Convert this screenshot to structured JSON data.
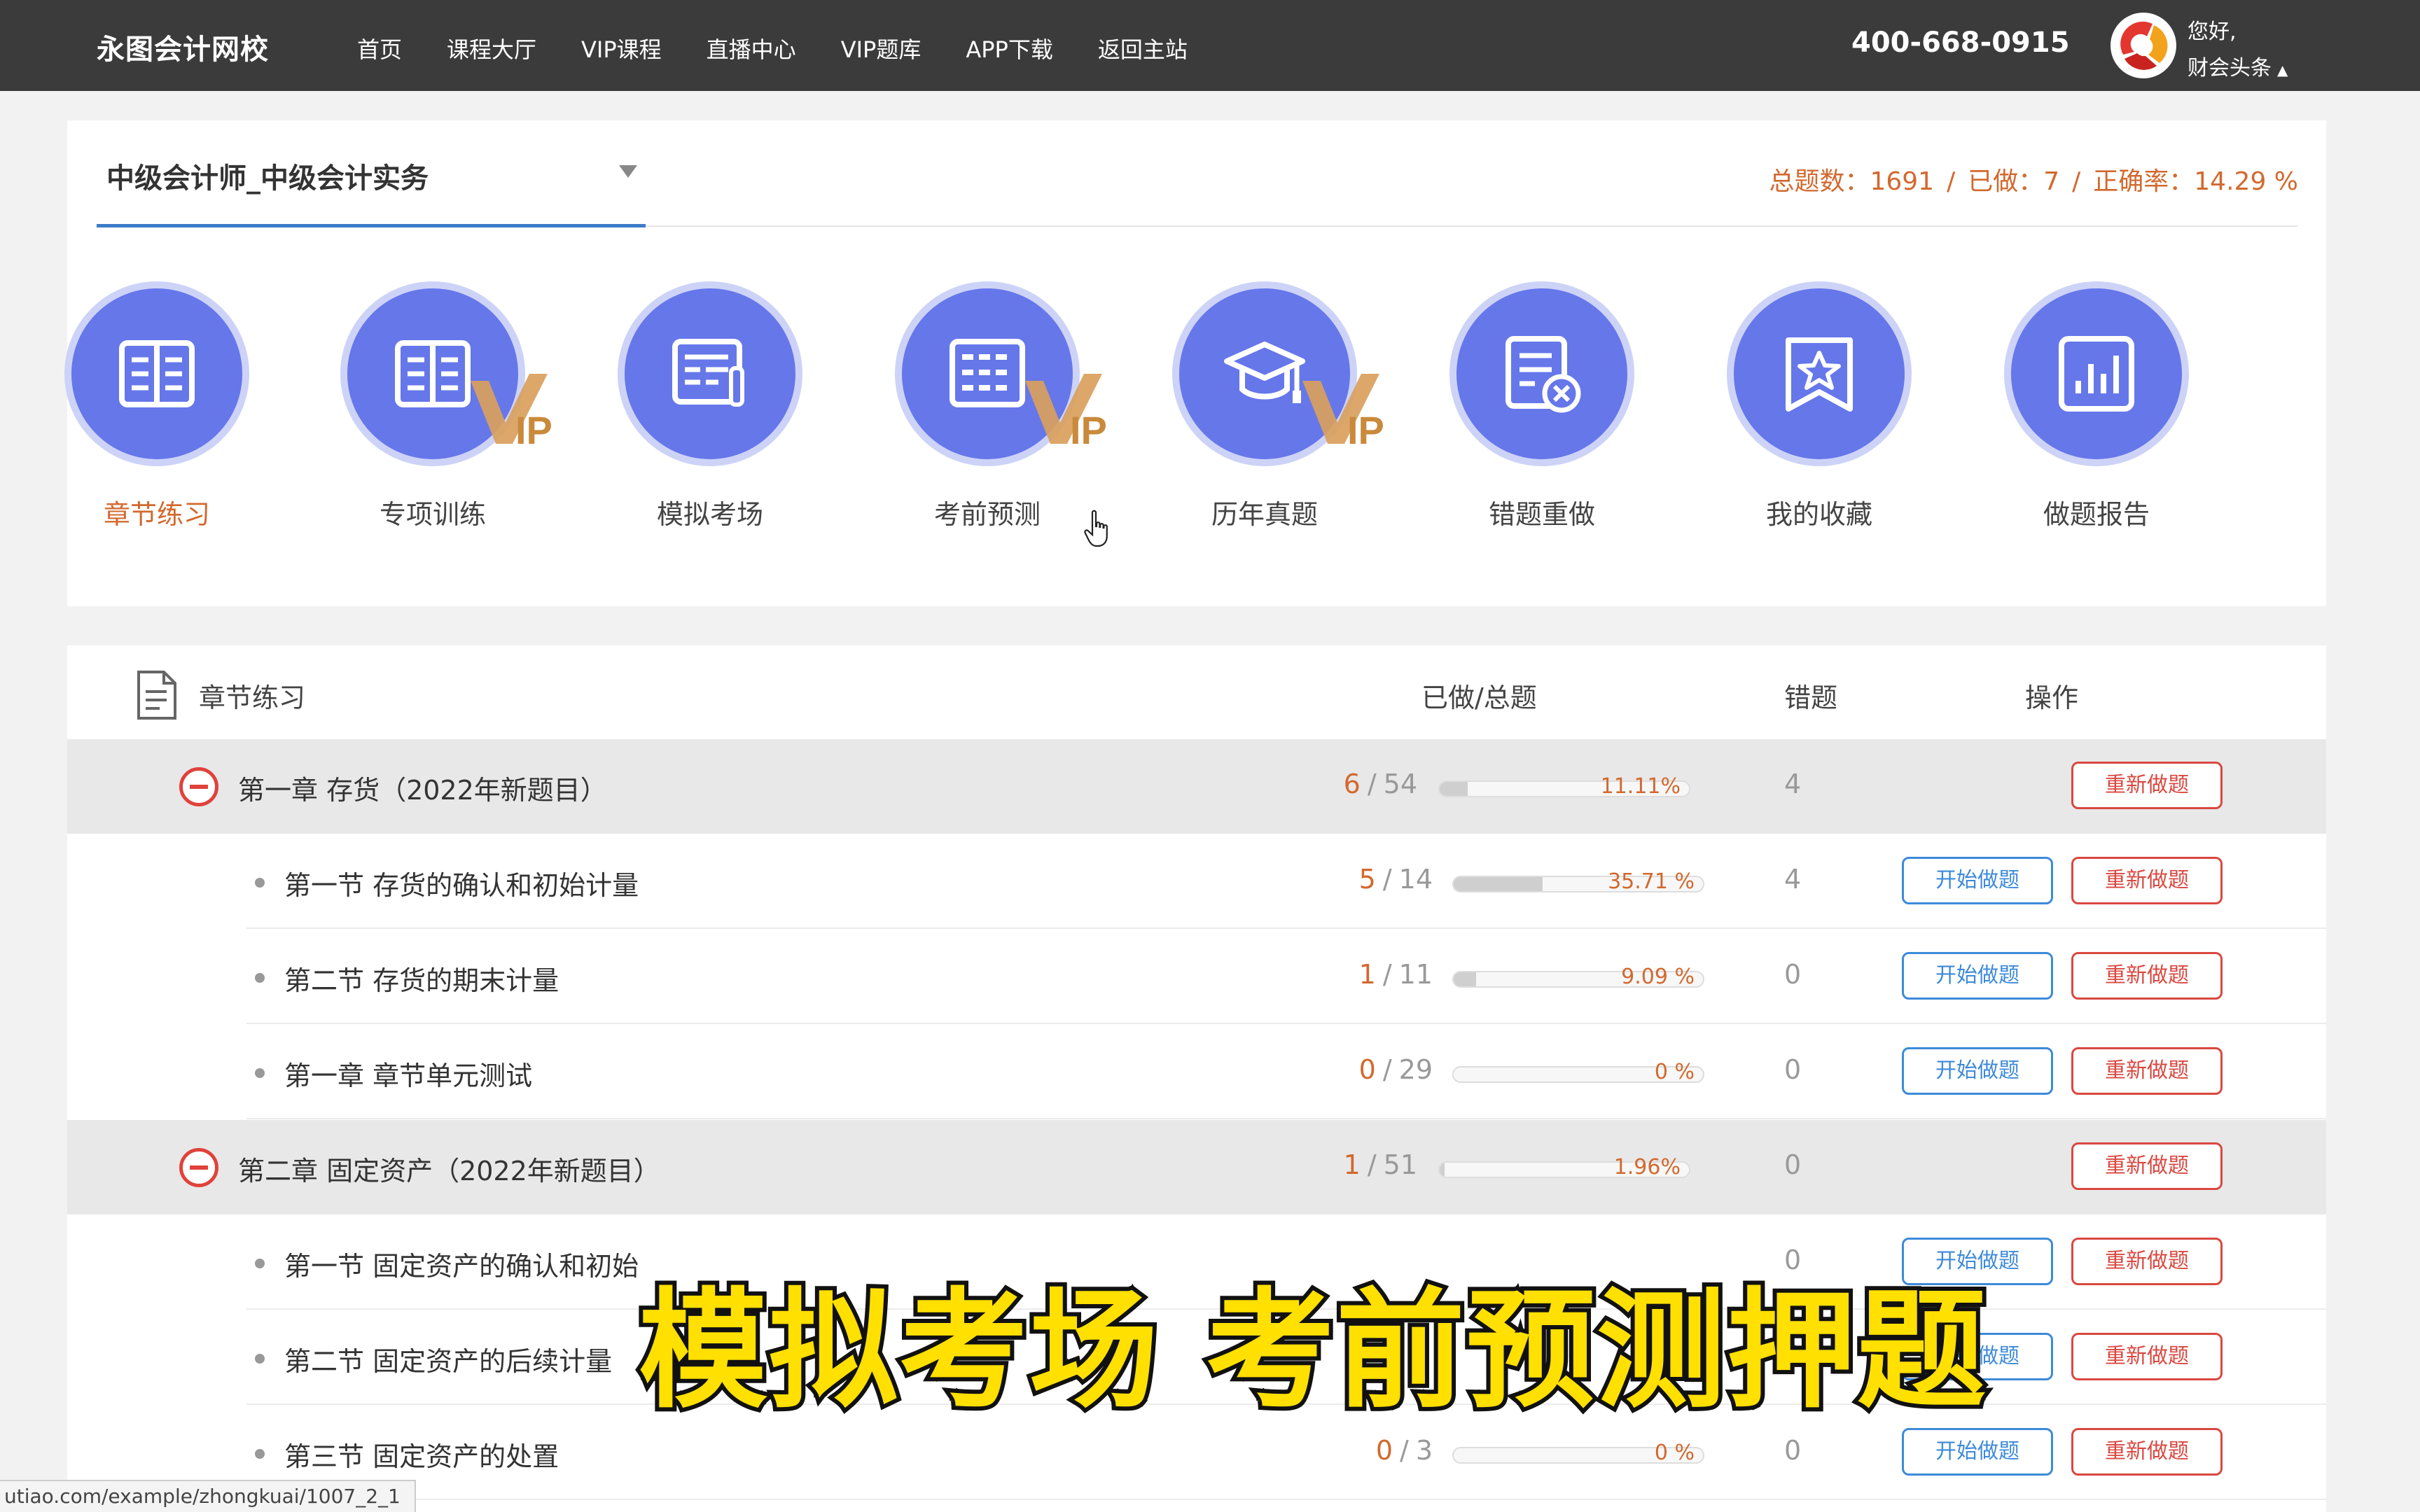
{
  "header": {
    "logo": "永图会计网校",
    "nav": [
      "首页",
      "课程大厅",
      "VIP课程",
      "直播中心",
      "VIP题库",
      "APP下载",
      "返回主站"
    ],
    "phone": "400-668-0915",
    "greeting": "您好,",
    "username": "财会头条"
  },
  "subject": {
    "title": "中级会计师_中级会计实务"
  },
  "stats": {
    "total": "总题数：1691",
    "done": "已做：7",
    "accuracy": "正确率：14.29 %",
    "sep": "/"
  },
  "features": [
    {
      "label": "章节练习",
      "icon": "book-icon",
      "vip": false,
      "active": true
    },
    {
      "label": "专项训练",
      "icon": "book-icon",
      "vip": true,
      "active": false
    },
    {
      "label": "模拟考场",
      "icon": "exam-paper-icon",
      "vip": false,
      "active": false
    },
    {
      "label": "考前预测",
      "icon": "grid-calendar-icon",
      "vip": true,
      "active": false
    },
    {
      "label": "历年真题",
      "icon": "graduation-cap-icon",
      "vip": true,
      "active": false
    },
    {
      "label": "错题重做",
      "icon": "wrong-document-icon",
      "vip": false,
      "active": false
    },
    {
      "label": "我的收藏",
      "icon": "star-bookmark-icon",
      "vip": false,
      "active": false
    },
    {
      "label": "做题报告",
      "icon": "bar-report-icon",
      "vip": false,
      "active": false
    }
  ],
  "vip_text": "IP",
  "table": {
    "col_title": "章节练习",
    "col_progress": "已做/总题",
    "col_wrong": "错题",
    "col_action": "操作",
    "start_label": "开始做题",
    "redo_label": "重新做题",
    "rows": [
      {
        "type": "chapter",
        "title": "第一章 存货（2022年新题目）",
        "done": "6",
        "total": "54",
        "progress": 0.1111,
        "pct": "11.11%",
        "wrong": "4"
      },
      {
        "type": "section",
        "title": "第一节 存货的确认和初始计量",
        "done": "5",
        "total": "14",
        "progress": 0.3571,
        "pct": "35.71 %",
        "wrong": "4"
      },
      {
        "type": "section",
        "title": "第二节 存货的期末计量",
        "done": "1",
        "total": "11",
        "progress": 0.0909,
        "pct": "9.09 %",
        "wrong": "0"
      },
      {
        "type": "section",
        "title": "第一章 章节单元测试",
        "done": "0",
        "total": "29",
        "progress": 0,
        "pct": "0 %",
        "wrong": "0"
      },
      {
        "type": "chapter",
        "title": "第二章 固定资产（2022年新题目）",
        "done": "1",
        "total": "51",
        "progress": 0.0196,
        "pct": "1.96%",
        "wrong": "0"
      },
      {
        "type": "section",
        "title": "第一节 固定资产的确认和初始",
        "done": "",
        "total": "",
        "progress": 0,
        "pct": "",
        "wrong": "0"
      },
      {
        "type": "section",
        "title": "第二节 固定资产的后续计量",
        "done": "",
        "total": "",
        "progress": 0,
        "pct": "",
        "wrong": "0"
      },
      {
        "type": "section",
        "title": "第三节 固定资产的处置",
        "done": "0",
        "total": "3",
        "progress": 0,
        "pct": "0 %",
        "wrong": "0"
      }
    ]
  },
  "caption": "模拟考场 考前预测押题",
  "status_url": "utiao.com/example/zhongkuai/1007_2_1",
  "colors": {
    "accent_orange": "#d2692e",
    "icon_purple": "#6677ea",
    "button_blue": "#3d8ad9",
    "button_red": "#d94840",
    "topbar": "#3b3b3b"
  }
}
